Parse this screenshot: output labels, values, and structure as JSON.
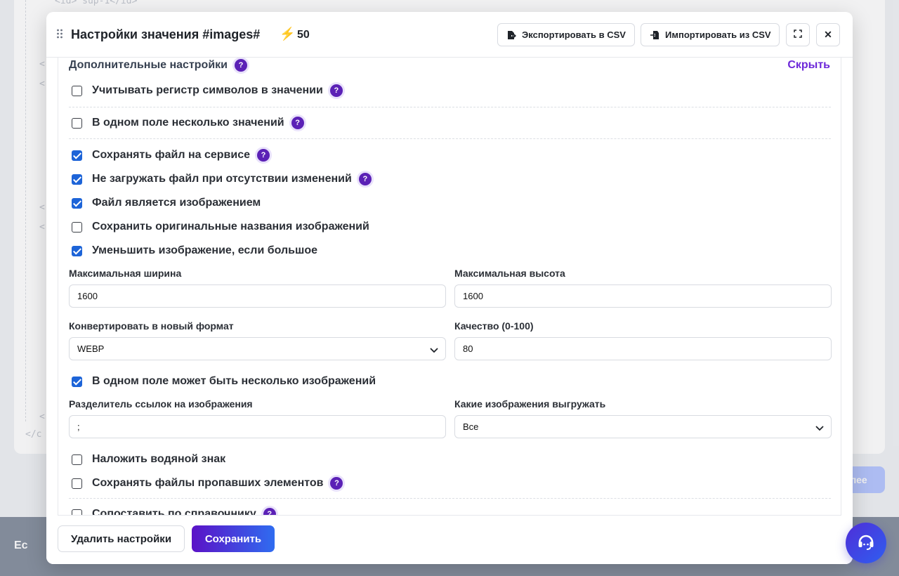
{
  "background": {
    "code_lines": [
      "<id> sup-1</id>",
      "<",
      "<",
      "<",
      "<",
      "<",
      "</c"
    ],
    "next_button_partial": "лее",
    "footer_logo_partial": "Ec"
  },
  "modal": {
    "title": "Настройки значения #images#",
    "credits": "50",
    "export_label": "Экспортировать в CSV",
    "import_label": "Импортировать из CSV",
    "close_symbol": "✕",
    "help_symbol": "?"
  },
  "section": {
    "title": "Дополнительные настройки",
    "hide_label": "Скрыть"
  },
  "options": [
    {
      "label": "Учитывать регистр символов в значении",
      "checked": false,
      "help": true
    },
    {
      "label": "В одном поле несколько значений",
      "checked": false,
      "help": true
    },
    {
      "label": "Сохранять файл на сервисе",
      "checked": true,
      "help": true
    },
    {
      "label": "Не загружать файл при отсутствии изменений",
      "checked": true,
      "help": true
    },
    {
      "label": "Файл является изображением",
      "checked": true,
      "help": false
    },
    {
      "label": "Сохранить оригинальные названия изображений",
      "checked": false,
      "help": false
    },
    {
      "label": "Уменьшить изображение, если большое",
      "checked": true,
      "help": false
    },
    {
      "label": "В одном поле может быть несколько изображений",
      "checked": true,
      "help": false
    },
    {
      "label": "Наложить водяной знак",
      "checked": false,
      "help": false
    },
    {
      "label": "Сохранять файлы пропавших элементов",
      "checked": false,
      "help": true
    },
    {
      "label": "Сопоставить по справочнику",
      "checked": false,
      "help": true
    }
  ],
  "fields": {
    "max_width": {
      "label": "Максимальная ширина",
      "value": "1600"
    },
    "max_height": {
      "label": "Максимальная высота",
      "value": "1600"
    },
    "format": {
      "label": "Конвертировать в новый формат",
      "value": "WEBP"
    },
    "quality": {
      "label": "Качество (0-100)",
      "value": "80"
    },
    "separator": {
      "label": "Разделитель ссылок на изображения",
      "value": ";"
    },
    "which_images": {
      "label": "Какие изображения выгружать",
      "value": "Все"
    }
  },
  "footer": {
    "delete_label": "Удалить настройки",
    "save_label": "Сохранить"
  },
  "colors": {
    "accent_purple": "#5b21b6",
    "checkbox_blue": "#1d64d8",
    "link_purple": "#6d28d9"
  }
}
